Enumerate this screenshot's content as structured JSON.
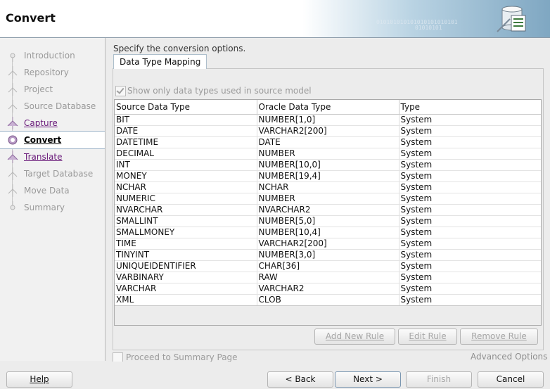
{
  "header": {
    "title": "Convert",
    "binary1": "010101010101010101010101",
    "binary2": "01010101"
  },
  "nav": {
    "steps": [
      {
        "label": "Introduction",
        "state": "disabled"
      },
      {
        "label": "Repository",
        "state": "disabled"
      },
      {
        "label": "Project",
        "state": "disabled"
      },
      {
        "label": "Source Database",
        "state": "disabled"
      },
      {
        "label": "Capture",
        "state": "link"
      },
      {
        "label": "Convert",
        "state": "active"
      },
      {
        "label": "Translate",
        "state": "link"
      },
      {
        "label": "Target Database",
        "state": "disabled"
      },
      {
        "label": "Move Data",
        "state": "disabled"
      },
      {
        "label": "Summary",
        "state": "disabled"
      }
    ]
  },
  "main": {
    "instruction": "Specify the conversion options.",
    "tab_label": "Data Type Mapping",
    "show_only_label": "Show only data types used in source model",
    "columns": [
      "Source Data Type",
      "Oracle Data Type",
      "Type"
    ],
    "rows": [
      [
        "BIT",
        "NUMBER[1,0]",
        "System"
      ],
      [
        "DATE",
        "VARCHAR2[200]",
        "System"
      ],
      [
        "DATETIME",
        "DATE",
        "System"
      ],
      [
        "DECIMAL",
        "NUMBER",
        "System"
      ],
      [
        "INT",
        "NUMBER[10,0]",
        "System"
      ],
      [
        "MONEY",
        "NUMBER[19,4]",
        "System"
      ],
      [
        "NCHAR",
        "NCHAR",
        "System"
      ],
      [
        "NUMERIC",
        "NUMBER",
        "System"
      ],
      [
        "NVARCHAR",
        "NVARCHAR2",
        "System"
      ],
      [
        "SMALLINT",
        "NUMBER[5,0]",
        "System"
      ],
      [
        "SMALLMONEY",
        "NUMBER[10,4]",
        "System"
      ],
      [
        "TIME",
        "VARCHAR2[200]",
        "System"
      ],
      [
        "TINYINT",
        "NUMBER[3,0]",
        "System"
      ],
      [
        "UNIQUEIDENTIFIER",
        "CHAR[36]",
        "System"
      ],
      [
        "VARBINARY",
        "RAW",
        "System"
      ],
      [
        "VARCHAR",
        "VARCHAR2",
        "System"
      ],
      [
        "XML",
        "CLOB",
        "System"
      ]
    ],
    "add_rule": "Add New Rule",
    "edit_rule": "Edit Rule",
    "remove_rule": "Remove Rule",
    "proceed_label": "Proceed to Summary Page",
    "advanced": "Advanced Options"
  },
  "footer": {
    "help": "Help",
    "back": "< Back",
    "next": "Next >",
    "finish": "Finish",
    "cancel": "Cancel"
  },
  "colors": {
    "link": "#6a1a7a",
    "disabled": "#9a9a9a",
    "accent": "#7fa7c2"
  }
}
